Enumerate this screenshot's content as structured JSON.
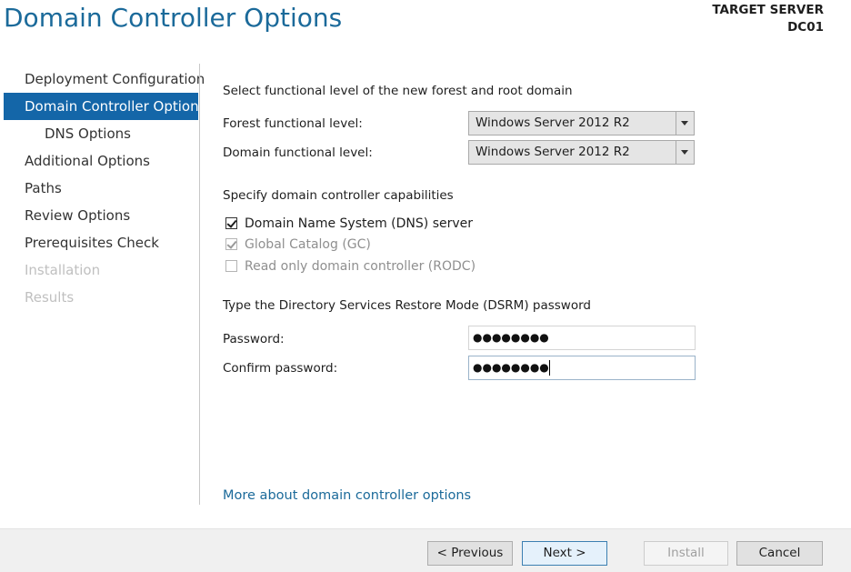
{
  "header": {
    "title": "Domain Controller Options",
    "target_server_label": "TARGET SERVER",
    "target_server_name": "DC01"
  },
  "nav": {
    "items": [
      {
        "label": "Deployment Configuration",
        "state": "normal"
      },
      {
        "label": "Domain Controller Options",
        "state": "active"
      },
      {
        "label": "DNS Options",
        "state": "sub"
      },
      {
        "label": "Additional Options",
        "state": "normal"
      },
      {
        "label": "Paths",
        "state": "normal"
      },
      {
        "label": "Review Options",
        "state": "normal"
      },
      {
        "label": "Prerequisites Check",
        "state": "normal"
      },
      {
        "label": "Installation",
        "state": "disabled"
      },
      {
        "label": "Results",
        "state": "disabled"
      }
    ]
  },
  "functional_level": {
    "heading": "Select functional level of the new forest and root domain",
    "forest_label": "Forest functional level:",
    "forest_value": "Windows Server 2012 R2",
    "domain_label": "Domain functional level:",
    "domain_value": "Windows Server 2012 R2"
  },
  "capabilities": {
    "heading": "Specify domain controller capabilities",
    "dns": {
      "label": "Domain Name System (DNS) server",
      "checked": true,
      "enabled": true
    },
    "gc": {
      "label": "Global Catalog (GC)",
      "checked": true,
      "enabled": false
    },
    "rodc": {
      "label": "Read only domain controller (RODC)",
      "checked": false,
      "enabled": false
    }
  },
  "dsrm": {
    "heading": "Type the Directory Services Restore Mode (DSRM) password",
    "password_label": "Password:",
    "password_value": "●●●●●●●●",
    "confirm_label": "Confirm password:",
    "confirm_value": "●●●●●●●●"
  },
  "links": {
    "more": "More about domain controller options"
  },
  "footer": {
    "previous": "< Previous",
    "next": "Next >",
    "install": "Install",
    "cancel": "Cancel"
  },
  "colors": {
    "accent": "#1466a8",
    "title": "#1b6a9a",
    "disabled_text": "#c0c0c0"
  }
}
